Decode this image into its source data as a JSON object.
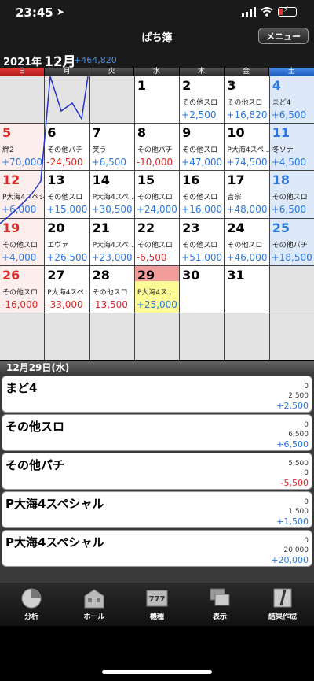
{
  "status": {
    "time": "23:45",
    "location_glyph": "➤"
  },
  "nav": {
    "title": "ぱち簿",
    "menu_label": "メニュー"
  },
  "month": {
    "year": "2021年",
    "month": "12月",
    "total": "+464,820"
  },
  "weekdays": [
    "日",
    "月",
    "火",
    "水",
    "木",
    "金",
    "土"
  ],
  "calendar": {
    "cells": [
      {
        "day": "",
        "machine": "",
        "amount": ""
      },
      {
        "day": "",
        "machine": "",
        "amount": ""
      },
      {
        "day": "",
        "machine": "",
        "amount": ""
      },
      {
        "day": "1",
        "machine": "",
        "amount": ""
      },
      {
        "day": "2",
        "machine": "その他スロ",
        "amount": "+2,500"
      },
      {
        "day": "3",
        "machine": "その他スロ",
        "amount": "+16,820"
      },
      {
        "day": "4",
        "machine": "まど4",
        "amount": "+6,500"
      },
      {
        "day": "5",
        "machine": "絆2",
        "amount": "+70,000"
      },
      {
        "day": "6",
        "machine": "その他パチ",
        "amount": "-24,500"
      },
      {
        "day": "7",
        "machine": "笑う",
        "amount": "+6,500"
      },
      {
        "day": "8",
        "machine": "その他パチ",
        "amount": "-10,000"
      },
      {
        "day": "9",
        "machine": "その他スロ",
        "amount": "+47,000"
      },
      {
        "day": "10",
        "machine": "P大海4スペ...",
        "amount": "+74,500"
      },
      {
        "day": "11",
        "machine": "冬ソナ",
        "amount": "+4,500"
      },
      {
        "day": "12",
        "machine": "P大海4スペシ",
        "amount": "+6,000"
      },
      {
        "day": "13",
        "machine": "その他スロ",
        "amount": "+15,000"
      },
      {
        "day": "14",
        "machine": "P大海4スペ...",
        "amount": "+30,500"
      },
      {
        "day": "15",
        "machine": "その他スロ",
        "amount": "+24,000"
      },
      {
        "day": "16",
        "machine": "その他スロ",
        "amount": "+16,000"
      },
      {
        "day": "17",
        "machine": "吉宗",
        "amount": "+48,000"
      },
      {
        "day": "18",
        "machine": "その他スロ",
        "amount": "+6,500"
      },
      {
        "day": "19",
        "machine": "その他スロ",
        "amount": "+4,000"
      },
      {
        "day": "20",
        "machine": "エヴァ",
        "amount": "+26,500"
      },
      {
        "day": "21",
        "machine": "P大海4スペ...",
        "amount": "+23,000"
      },
      {
        "day": "22",
        "machine": "その他スロ",
        "amount": "-6,500"
      },
      {
        "day": "23",
        "machine": "その他スロ",
        "amount": "+51,000"
      },
      {
        "day": "24",
        "machine": "その他スロ",
        "amount": "+46,000"
      },
      {
        "day": "25",
        "machine": "その他パチ",
        "amount": "+18,500"
      },
      {
        "day": "26",
        "machine": "その他スロ",
        "amount": "-16,000"
      },
      {
        "day": "27",
        "machine": "P大海4スペ...",
        "amount": "-33,000"
      },
      {
        "day": "28",
        "machine": "その他スロ",
        "amount": "-13,500"
      },
      {
        "day": "29",
        "machine": "P大海4ス...",
        "amount": "+25,000"
      },
      {
        "day": "30",
        "machine": "",
        "amount": ""
      },
      {
        "day": "31",
        "machine": "",
        "amount": ""
      },
      {
        "day": "",
        "machine": "",
        "amount": ""
      },
      {
        "day": "",
        "machine": "",
        "amount": ""
      },
      {
        "day": "",
        "machine": "",
        "amount": ""
      },
      {
        "day": "",
        "machine": "",
        "amount": ""
      },
      {
        "day": "",
        "machine": "",
        "amount": ""
      },
      {
        "day": "",
        "machine": "",
        "amount": ""
      },
      {
        "day": "",
        "machine": "",
        "amount": ""
      },
      {
        "day": "",
        "machine": "",
        "amount": ""
      }
    ],
    "selected_day": "29",
    "colors": {
      "sunday": "#e02a2a",
      "saturday": "#2a78e0",
      "positive": "#2a78e0",
      "negative": "#e02a2a",
      "selected": "#fdfb95"
    }
  },
  "selected_date": "12月29日(水)",
  "entries": [
    {
      "name": "まど4",
      "v1": "0",
      "v2": "2,500",
      "v3": "+2,500"
    },
    {
      "name": "その他スロ",
      "v1": "0",
      "v2": "6,500",
      "v3": "+6,500"
    },
    {
      "name": "その他パチ",
      "v1": "5,500",
      "v2": "0",
      "v3": "-5,500"
    },
    {
      "name": "P大海4スペシャル",
      "v1": "0",
      "v2": "1,500",
      "v3": "+1,500"
    },
    {
      "name": "P大海4スペシャル",
      "v1": "0",
      "v2": "20,000",
      "v3": "+20,000"
    }
  ],
  "tabs": [
    {
      "label": "分析",
      "icon": "pie-chart-icon"
    },
    {
      "label": "ホール",
      "icon": "building-icon"
    },
    {
      "label": "機種",
      "icon": "slot-machine-icon"
    },
    {
      "label": "表示",
      "icon": "windows-icon"
    },
    {
      "label": "結果作成",
      "icon": "edit-note-icon"
    }
  ]
}
